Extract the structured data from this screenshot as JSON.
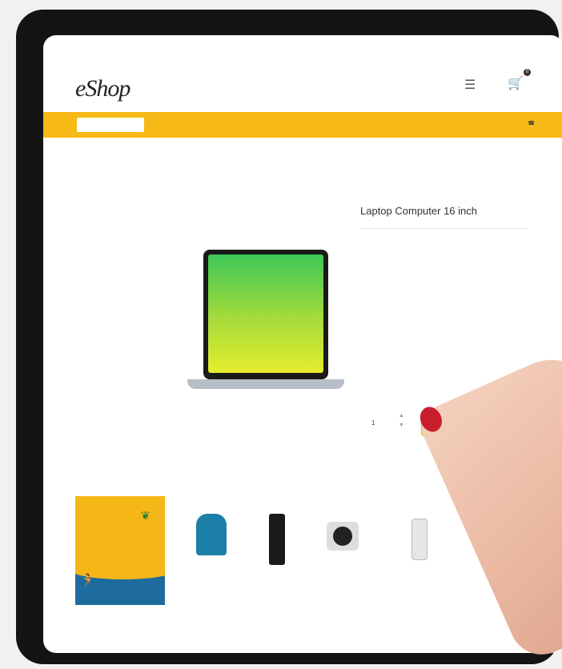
{
  "colors": {
    "accent": "#f6b916",
    "device_frame": "#141414",
    "promo_blue": "#1e6c9d"
  },
  "topbar": {
    "left_text": "",
    "links": [
      "",
      "",
      ""
    ]
  },
  "header": {
    "logo": "eShop",
    "nav": [
      "",
      "",
      "",
      "",
      ""
    ],
    "icons": {
      "menu": "menu-icon",
      "cart": "cart-icon"
    },
    "cart_count": "0"
  },
  "search": {
    "placeholder": ""
  },
  "phone": "",
  "breadcrumb": "",
  "sidebar": {
    "title1": "",
    "title2": "",
    "items": [
      "",
      "",
      "",
      "",
      "",
      "",
      "",
      ""
    ]
  },
  "product": {
    "category": "",
    "title": "Laptop Computer 16 inch",
    "sku": "",
    "rating_text": "",
    "description": "",
    "specs": [
      "",
      "",
      "",
      ""
    ],
    "price": "",
    "quantity": "1",
    "add_to_cart_label": ""
  },
  "promo": {
    "line1": "",
    "line2": ""
  },
  "related": [
    {
      "label": ""
    },
    {
      "label": ""
    },
    {
      "label": ""
    },
    {
      "label": ""
    }
  ]
}
